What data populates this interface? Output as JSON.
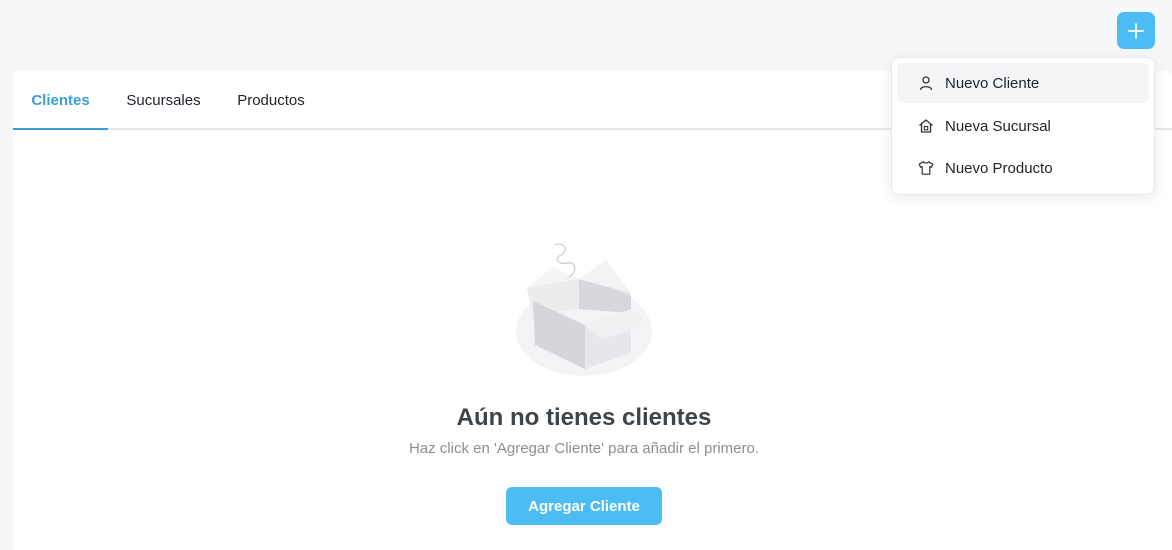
{
  "header": {
    "add_button_icon": "plus-icon",
    "accent_color": "#4cbcf5"
  },
  "tabs": [
    {
      "label": "Clientes",
      "active": true
    },
    {
      "label": "Sucursales",
      "active": false
    },
    {
      "label": "Productos",
      "active": false
    }
  ],
  "empty_state": {
    "illustration": "empty-box-illustration",
    "title": "Aún no tienes clientes",
    "subtitle": "Haz click en 'Agregar Cliente' para añadir el primero.",
    "cta_label": "Agregar Cliente"
  },
  "menu": {
    "items": [
      {
        "label": "Nuevo Cliente",
        "icon": "user-icon"
      },
      {
        "label": "Nueva Sucursal",
        "icon": "home-icon"
      },
      {
        "label": "Nuevo Producto",
        "icon": "shirt-icon"
      }
    ]
  }
}
